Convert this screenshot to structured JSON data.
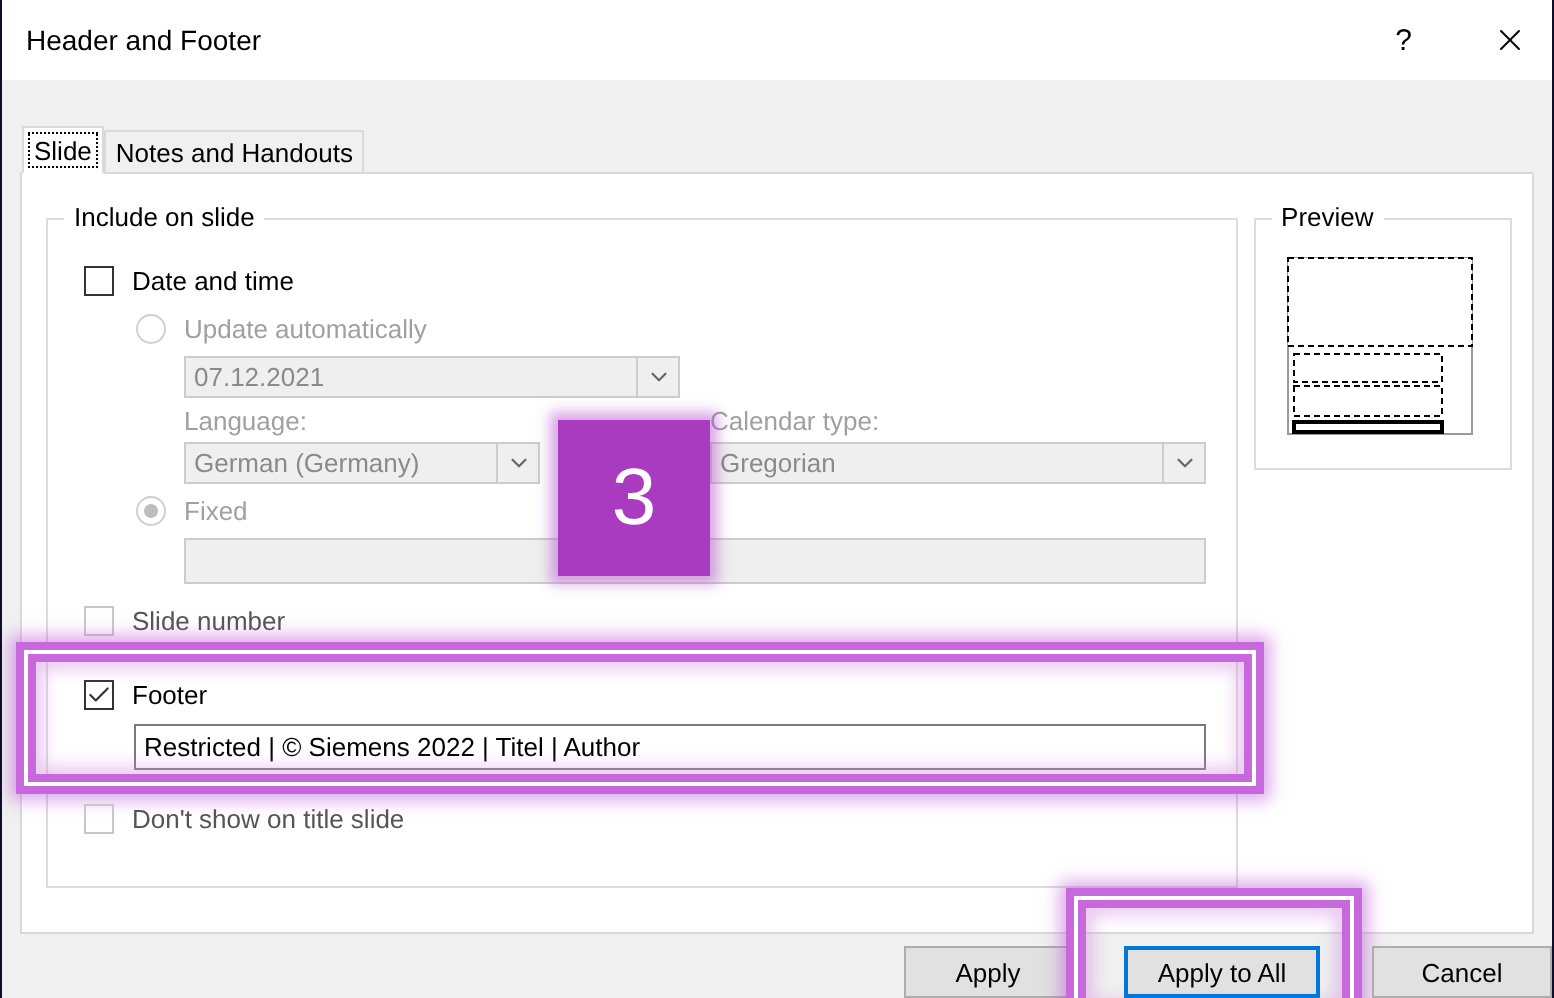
{
  "window": {
    "title": "Header and Footer",
    "help": "?"
  },
  "tabs": [
    {
      "label": "Slide",
      "selected": true
    },
    {
      "label": "Notes and Handouts",
      "selected": false
    }
  ],
  "include_group": {
    "title": "Include on slide",
    "date_and_time": {
      "label": "Date and time",
      "checked": false,
      "update_automatically": {
        "label": "Update automatically",
        "selected": false,
        "disabled": true
      },
      "date_select": {
        "value": "07.12.2021",
        "disabled": true
      },
      "language": {
        "label": "Language:",
        "value": "German (Germany)",
        "disabled": true
      },
      "calendar_type": {
        "label": "Calendar type:",
        "value": "Gregorian",
        "disabled": true
      },
      "fixed": {
        "label": "Fixed",
        "selected": true,
        "disabled": true
      },
      "fixed_field": {
        "disabled": true
      }
    },
    "options": [
      {
        "label": "Slide number",
        "checked": false,
        "highlighted": false
      },
      {
        "label": "Footer",
        "checked": true,
        "highlighted": true,
        "field": {
          "value": "Restricted | © Siemens 2022 | Titel | Author"
        }
      },
      {
        "label": "Don't show on title slide",
        "checked": false,
        "highlighted": false
      }
    ]
  },
  "preview": {
    "title": "Preview"
  },
  "buttons": [
    {
      "label": "Apply",
      "default": false,
      "highlighted": false
    },
    {
      "label": "Apply to All",
      "default": true,
      "highlighted": true
    },
    {
      "label": "Cancel",
      "default": false,
      "highlighted": false
    }
  ],
  "step_badge": {
    "text": "3"
  }
}
